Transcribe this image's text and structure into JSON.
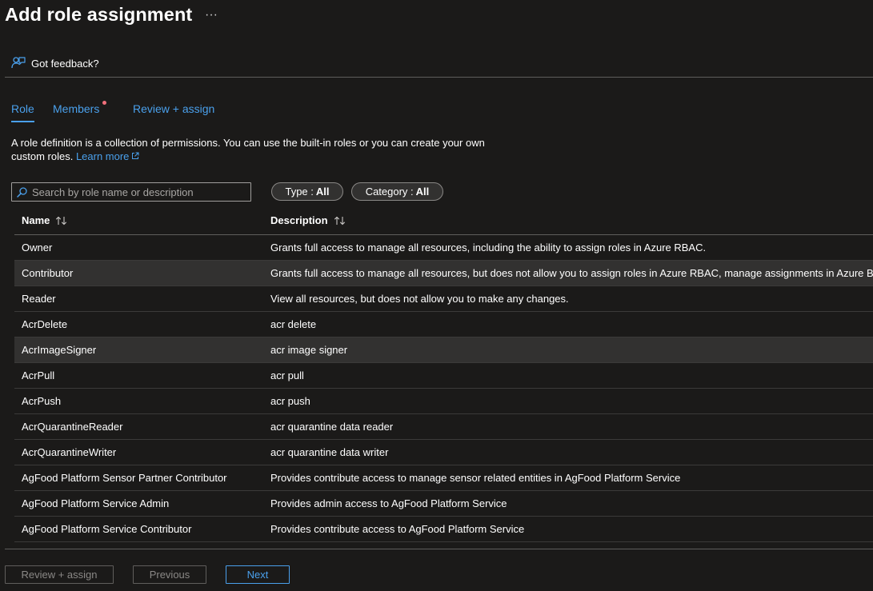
{
  "header": {
    "title": "Add role assignment",
    "more_label": "···",
    "feedback_label": "Got feedback?"
  },
  "tabs": [
    {
      "label": "Role",
      "active": true
    },
    {
      "label": "Members",
      "active": false,
      "has_dot": true
    },
    {
      "label": "Review + assign",
      "active": false
    }
  ],
  "intro": {
    "text": "A role definition is a collection of permissions. You can use the built-in roles or you can create your own custom roles.",
    "link_label": "Learn more"
  },
  "search": {
    "placeholder": "Search by role name or description",
    "value": ""
  },
  "filters": {
    "type": {
      "label": "Type :",
      "value": "All"
    },
    "category": {
      "label": "Category :",
      "value": "All"
    }
  },
  "table": {
    "columns": {
      "name": "Name",
      "description": "Description"
    },
    "rows": [
      {
        "name": "Owner",
        "description": "Grants full access to manage all resources, including the ability to assign roles in Azure RBAC."
      },
      {
        "name": "Contributor",
        "description": "Grants full access to manage all resources, but does not allow you to assign roles in Azure RBAC, manage assignments in Azure Blu..."
      },
      {
        "name": "Reader",
        "description": "View all resources, but does not allow you to make any changes."
      },
      {
        "name": "AcrDelete",
        "description": "acr delete"
      },
      {
        "name": "AcrImageSigner",
        "description": "acr image signer"
      },
      {
        "name": "AcrPull",
        "description": "acr pull"
      },
      {
        "name": "AcrPush",
        "description": "acr push"
      },
      {
        "name": "AcrQuarantineReader",
        "description": "acr quarantine data reader"
      },
      {
        "name": "AcrQuarantineWriter",
        "description": "acr quarantine data writer"
      },
      {
        "name": "AgFood Platform Sensor Partner Contributor",
        "description": "Provides contribute access to manage sensor related entities in AgFood Platform Service"
      },
      {
        "name": "AgFood Platform Service Admin",
        "description": "Provides admin access to AgFood Platform Service"
      },
      {
        "name": "AgFood Platform Service Contributor",
        "description": "Provides contribute access to AgFood Platform Service"
      }
    ]
  },
  "footer": {
    "review_label": "Review + assign",
    "previous_label": "Previous",
    "next_label": "Next"
  },
  "colors": {
    "background": "#1b1a19",
    "accent": "#4aa0ec",
    "row_highlight": "#323130",
    "required_dot": "#f1707b"
  },
  "icons": {
    "feedback": "feedback-person-icon",
    "search": "search-icon",
    "external_link": "external-link-icon",
    "sort": "sort-arrows-icon"
  }
}
